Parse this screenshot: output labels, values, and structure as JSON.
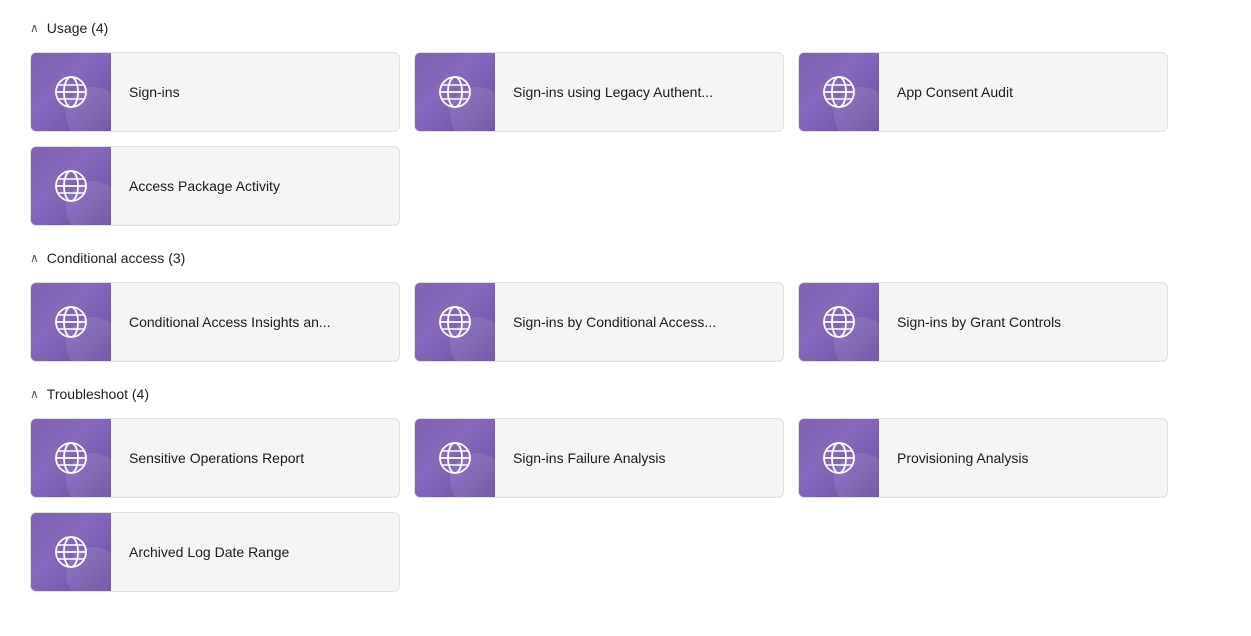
{
  "sections": [
    {
      "id": "usage",
      "title": "Usage (4)",
      "expanded": true,
      "cards": [
        {
          "id": "sign-ins",
          "label": "Sign-ins"
        },
        {
          "id": "sign-ins-legacy",
          "label": "Sign-ins using Legacy Authent..."
        },
        {
          "id": "app-consent-audit",
          "label": "App Consent Audit"
        },
        {
          "id": "access-package-activity",
          "label": "Access Package Activity"
        }
      ]
    },
    {
      "id": "conditional-access",
      "title": "Conditional access (3)",
      "expanded": true,
      "cards": [
        {
          "id": "conditional-access-insights",
          "label": "Conditional Access Insights an..."
        },
        {
          "id": "sign-ins-by-conditional-access",
          "label": "Sign-ins by Conditional Access..."
        },
        {
          "id": "sign-ins-by-grant-controls",
          "label": "Sign-ins by Grant Controls"
        }
      ]
    },
    {
      "id": "troubleshoot",
      "title": "Troubleshoot (4)",
      "expanded": true,
      "cards": [
        {
          "id": "sensitive-operations-report",
          "label": "Sensitive Operations Report"
        },
        {
          "id": "sign-ins-failure-analysis",
          "label": "Sign-ins Failure Analysis"
        },
        {
          "id": "provisioning-analysis",
          "label": "Provisioning Analysis"
        },
        {
          "id": "archived-log-date-range",
          "label": "Archived Log Date Range"
        }
      ]
    }
  ]
}
